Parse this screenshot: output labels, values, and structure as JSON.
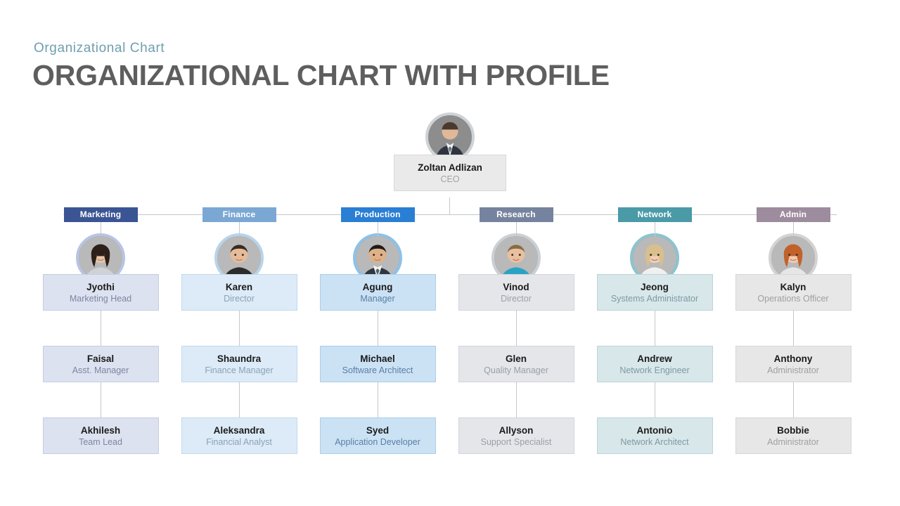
{
  "header": {
    "kicker": "Organizational  Chart",
    "title": "ORGANIZATIONAL CHART WITH PROFILE",
    "kicker_color": "#6f9fb0",
    "title_color": "#5e5e5e"
  },
  "ceo": {
    "name": "Zoltan Adlizan",
    "role": "CEO",
    "avatar_icon": "person-photo-avatar",
    "card_bg": "#eaeaea",
    "ring_color": "#cfd3d6"
  },
  "columns": [
    {
      "dept": "Marketing",
      "dept_color": "#3a5494",
      "card_bg": "#dde2f0",
      "card_border": "#c6cde2",
      "role_color": "#7d86a0",
      "ring_color": "#b9c4e4",
      "avatar_icon": "person-photo-avatar",
      "people": [
        {
          "name": "Jyothi",
          "role": "Marketing Head"
        },
        {
          "name": "Faisal",
          "role": "Asst. Manager"
        },
        {
          "name": "Akhilesh",
          "role": "Team Lead"
        }
      ]
    },
    {
      "dept": "Finance",
      "dept_color": "#7ba7d4",
      "card_bg": "#dcebf7",
      "card_border": "#c3d9ec",
      "role_color": "#8ba2b8",
      "ring_color": "#b8d4ea",
      "avatar_icon": "person-photo-avatar",
      "people": [
        {
          "name": "Karen",
          "role": "Director"
        },
        {
          "name": "Shaundra",
          "role": "Finance Manager"
        },
        {
          "name": "Aleksandra",
          "role": "Financial Analyst"
        }
      ]
    },
    {
      "dept": "Production",
      "dept_color": "#2a7fd4",
      "card_bg": "#cbe2f5",
      "card_border": "#aecde8",
      "role_color": "#5a7ea4",
      "ring_color": "#8dc2e8",
      "avatar_icon": "person-photo-avatar",
      "people": [
        {
          "name": "Agung",
          "role": "Manager"
        },
        {
          "name": "Michael",
          "role": "Software Architect"
        },
        {
          "name": "Syed",
          "role": "Application Developer"
        }
      ]
    },
    {
      "dept": "Research",
      "dept_color": "#76839e",
      "card_bg": "#e4e6ea",
      "card_border": "#d2d5da",
      "role_color": "#9aa0a8",
      "ring_color": "#cbd0d6",
      "avatar_icon": "person-photo-avatar",
      "people": [
        {
          "name": "Vinod",
          "role": "Director"
        },
        {
          "name": "Glen",
          "role": "Quality Manager"
        },
        {
          "name": "Allyson",
          "role": "Support Specialist"
        }
      ]
    },
    {
      "dept": "Network",
      "dept_color": "#4a9aa8",
      "card_bg": "#d8e7ea",
      "card_border": "#bcd4d9",
      "role_color": "#7d9aa2",
      "ring_color": "#8cc4cf",
      "avatar_icon": "person-photo-avatar",
      "people": [
        {
          "name": "Jeong",
          "role": "Systems Administrator"
        },
        {
          "name": "Andrew",
          "role": "Network Engineer"
        },
        {
          "name": "Antonio",
          "role": "Network Architect"
        }
      ]
    },
    {
      "dept": "Admin",
      "dept_color": "#9d8b9e",
      "card_bg": "#e7e7e7",
      "card_border": "#d6d6d6",
      "role_color": "#a0a0a0",
      "ring_color": "#d3d3d3",
      "avatar_icon": "person-photo-avatar",
      "people": [
        {
          "name": "Kalyn",
          "role": "Operations Officer"
        },
        {
          "name": "Anthony",
          "role": "Administrator"
        },
        {
          "name": "Bobbie",
          "role": "Administrator"
        }
      ]
    }
  ]
}
